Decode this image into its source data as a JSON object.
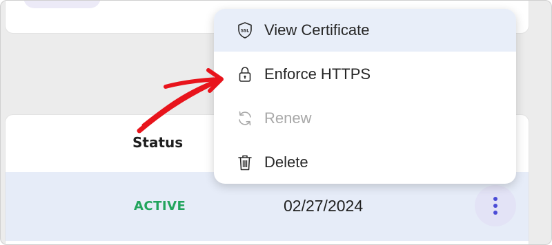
{
  "table": {
    "columns": {
      "status_header": "Status"
    },
    "row": {
      "status": "ACTIVE",
      "date": "02/27/2024"
    }
  },
  "menu": {
    "items": [
      {
        "label": "View Certificate",
        "icon": "ssl-shield-icon",
        "state": "highlighted"
      },
      {
        "label": "Enforce HTTPS",
        "icon": "lock-icon",
        "state": "normal"
      },
      {
        "label": "Renew",
        "icon": "refresh-icon",
        "state": "disabled"
      },
      {
        "label": "Delete",
        "icon": "trash-icon",
        "state": "normal"
      }
    ]
  },
  "colors": {
    "accent": "#4b4cd6",
    "status_active": "#22a45d",
    "annotation_arrow": "#e8141c",
    "menu_highlight": "#e8eef9",
    "row_highlight": "#e6ecf8"
  }
}
